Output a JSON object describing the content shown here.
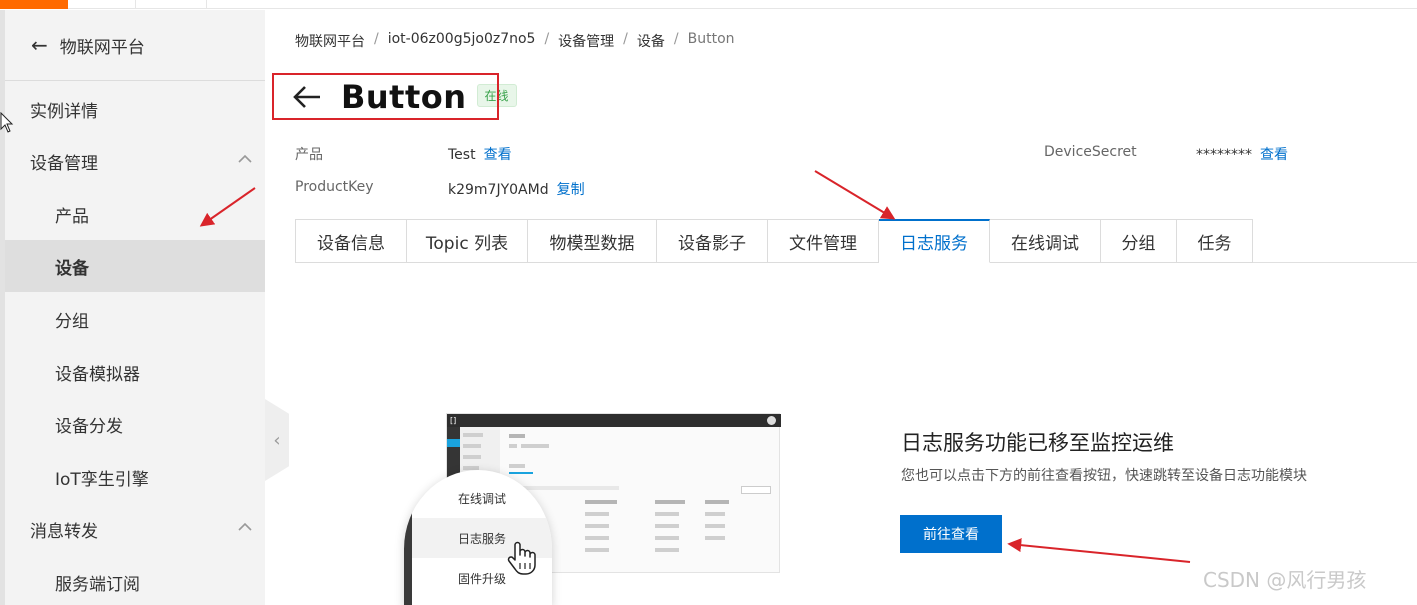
{
  "sidebar": {
    "title": "物联网平台",
    "items": [
      {
        "label": "实例详情"
      },
      {
        "label": "设备管理"
      },
      {
        "label": "产品"
      },
      {
        "label": "设备"
      },
      {
        "label": "分组"
      },
      {
        "label": "设备模拟器"
      },
      {
        "label": "设备分发"
      },
      {
        "label": "IoT孪生引擎"
      },
      {
        "label": "消息转发"
      },
      {
        "label": "服务端订阅"
      }
    ]
  },
  "breadcrumb": [
    "物联网平台",
    "iot-06z00g5jo0z7no5",
    "设备管理",
    "设备",
    "Button"
  ],
  "device": {
    "name": "Button",
    "status": "在线",
    "product_label": "产品",
    "product_value": "Test",
    "view_link": "查看",
    "productkey_label": "ProductKey",
    "productkey_value": "k29m7JY0AMd",
    "copy_link": "复制",
    "secret_label": "DeviceSecret",
    "secret_value": "********",
    "secret_view_link": "查看"
  },
  "tabs": [
    {
      "label": "设备信息"
    },
    {
      "label": "Topic 列表"
    },
    {
      "label": "物模型数据"
    },
    {
      "label": "设备影子"
    },
    {
      "label": "文件管理"
    },
    {
      "label": "日志服务"
    },
    {
      "label": "在线调试"
    },
    {
      "label": "分组"
    },
    {
      "label": "任务"
    }
  ],
  "illustration": {
    "menu": [
      "在线调试",
      "日志服务",
      "固件升级"
    ]
  },
  "notice": {
    "title": "日志服务功能已移至监控运维",
    "description": "您也可以点击下方的前往查看按钮，快速跳转至设备日志功能模块",
    "button": "前往查看"
  },
  "watermark": "CSDN @风行男孩",
  "colors": {
    "accent": "#0070cc",
    "brand": "#ff6a00",
    "annotation": "#d9242a",
    "online": "#39a24b"
  }
}
